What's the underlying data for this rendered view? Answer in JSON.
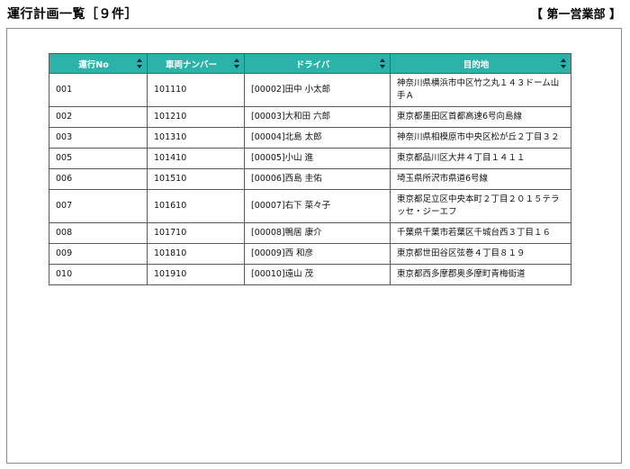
{
  "header": {
    "title": "運行計画一覧［９件］",
    "department": "【 第一営業部 】"
  },
  "table": {
    "columns": [
      "運行No",
      "車両ナンバー",
      "ドライバ",
      "目的地"
    ],
    "rows": [
      {
        "no": "001",
        "vehicle": "101110",
        "driver": "[00002]田中 小太郎",
        "destination": "神奈川県横浜市中区竹之丸１４３ドーム山手Ａ"
      },
      {
        "no": "002",
        "vehicle": "101210",
        "driver": "[00003]大和田 六郎",
        "destination": "東京都墨田区首都高速6号向島線"
      },
      {
        "no": "003",
        "vehicle": "101310",
        "driver": "[00004]北島 太郎",
        "destination": "神奈川県相模原市中央区松が丘２丁目３２"
      },
      {
        "no": "005",
        "vehicle": "101410",
        "driver": "[00005]小山 進",
        "destination": "東京都品川区大井４丁目１４１１"
      },
      {
        "no": "006",
        "vehicle": "101510",
        "driver": "[00006]西島 圭佑",
        "destination": "埼玉県所沢市県道6号線"
      },
      {
        "no": "007",
        "vehicle": "101610",
        "driver": "[00007]右下 菜々子",
        "destination": "東京都足立区中央本町２丁目２０１５テラッセ・ジーエフ"
      },
      {
        "no": "008",
        "vehicle": "101710",
        "driver": "[00008]鴨居 康介",
        "destination": "千葉県千葉市若葉区千城台西３丁目１６"
      },
      {
        "no": "009",
        "vehicle": "101810",
        "driver": "[00009]西 和彦",
        "destination": "東京都世田谷区弦巻４丁目８１９"
      },
      {
        "no": "010",
        "vehicle": "101910",
        "driver": "[00010]遠山 茂",
        "destination": "東京都西多摩郡奥多摩町青梅街道"
      }
    ]
  }
}
